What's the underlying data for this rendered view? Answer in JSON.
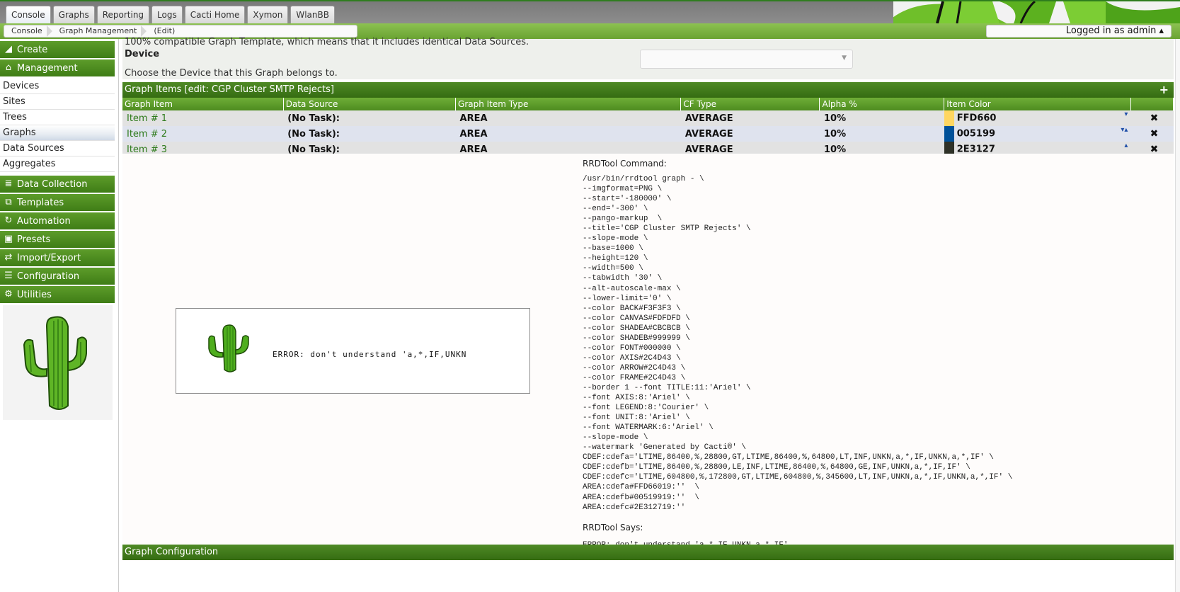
{
  "tabs": [
    "Console",
    "Graphs",
    "Reporting",
    "Logs",
    "Cacti Home",
    "Xymon",
    "WlanBB"
  ],
  "breadcrumb": [
    "Console",
    "Graph Management",
    "(Edit)"
  ],
  "login_text": "Logged in as admin ▴",
  "sidebar": {
    "create": "Create",
    "management": "Management",
    "items": [
      "Devices",
      "Sites",
      "Trees",
      "Graphs",
      "Data Sources",
      "Aggregates"
    ],
    "sections": [
      "Data Collection",
      "Templates",
      "Automation",
      "Presets",
      "Import/Export",
      "Configuration",
      "Utilities"
    ]
  },
  "device": {
    "cut_text": "100% compatible Graph Template, which means that it includes identical Data Sources.",
    "label": "Device",
    "description": "Choose the Device that this Graph belongs to.",
    "selected": ""
  },
  "graph_items": {
    "title": "Graph Items [edit: CGP Cluster SMTP Rejects]",
    "add_icon": "+",
    "columns": [
      "Graph Item",
      "Data Source",
      "Graph Item Type",
      "CF Type",
      "Alpha %",
      "Item Color"
    ],
    "rows": [
      {
        "item": "Item # 1",
        "source": "(No Task):",
        "type": "AREA",
        "cf": "AVERAGE",
        "alpha": "10%",
        "color": "FFD660",
        "hex": "#FFD660",
        "arrows": "▾"
      },
      {
        "item": "Item # 2",
        "source": "(No Task):",
        "type": "AREA",
        "cf": "AVERAGE",
        "alpha": "10%",
        "color": "005199",
        "hex": "#005199",
        "arrows": "▾▴"
      },
      {
        "item": "Item # 3",
        "source": "(No Task):",
        "type": "AREA",
        "cf": "AVERAGE",
        "alpha": "10%",
        "color": "2E3127",
        "hex": "#2E3127",
        "arrows": "▴"
      }
    ],
    "delete_icon": "✖"
  },
  "preview": {
    "error_image_text": "ERROR: don't understand 'a,*,IF,UNKN",
    "rrdtool_command_label": "RRDTool Command:",
    "rrdtool_command": "/usr/bin/rrdtool graph - \\\n--imgformat=PNG \\\n--start='-180000' \\\n--end='-300' \\\n--pango-markup  \\\n--title='CGP Cluster SMTP Rejects' \\\n--slope-mode \\\n--base=1000 \\\n--height=120 \\\n--width=500 \\\n--tabwidth '30' \\\n--alt-autoscale-max \\\n--lower-limit='0' \\\n--color BACK#F3F3F3 \\\n--color CANVAS#FDFDFD \\\n--color SHADEA#CBCBCB \\\n--color SHADEB#999999 \\\n--color FONT#000000 \\\n--color AXIS#2C4D43 \\\n--color ARROW#2C4D43 \\\n--color FRAME#2C4D43 \\\n--border 1 --font TITLE:11:'Ariel' \\\n--font AXIS:8:'Ariel' \\\n--font LEGEND:8:'Courier' \\\n--font UNIT:8:'Ariel' \\\n--font WATERMARK:6:'Ariel' \\\n--slope-mode \\\n--watermark 'Generated by Cacti®' \\\nCDEF:cdefa='LTIME,86400,%,28800,GT,LTIME,86400,%,64800,LT,INF,UNKN,a,*,IF,UNKN,a,*,IF' \\\nCDEF:cdefb='LTIME,86400,%,28800,LE,INF,LTIME,86400,%,64800,GE,INF,UNKN,a,*,IF,IF' \\\nCDEF:cdefc='LTIME,604800,%,172800,GT,LTIME,604800,%,345600,LT,INF,UNKN,a,*,IF,UNKN,a,*,IF' \\\nAREA:cdefa#FFD66019:''  \\\nAREA:cdefb#00519919:''  \\\nAREA:cdefc#2E312719:''",
    "rrdtool_says_label": "RRDTool Says:",
    "rrdtool_says": "ERROR: don't understand 'a,*,IF,UNKN,a,*,IF'"
  },
  "graph_configuration": {
    "title": "Graph Configuration"
  },
  "colors": {
    "green_dark": "#356c12",
    "green_light": "#8cc152",
    "link": "#2d7a1a"
  }
}
